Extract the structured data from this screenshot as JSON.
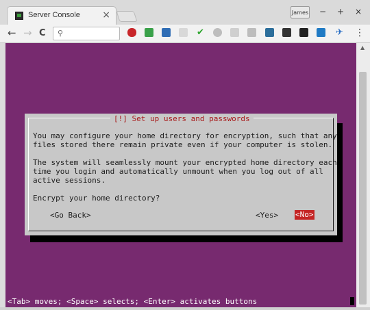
{
  "tab": {
    "title": "Server Console",
    "close": "×",
    "favicon": "terminal-favicon"
  },
  "profile": {
    "name": "James"
  },
  "window": {
    "minimize": "−",
    "maximize": "+",
    "close": "×"
  },
  "nav": {
    "back": "←",
    "forward": "→",
    "reload": "C",
    "search_icon": "🔍"
  },
  "extensions": [
    "ublock-icon",
    "dropbox-icon",
    "stack-icon",
    "puzzle-icon",
    "check-icon",
    "clock-icon",
    "chart-icon",
    "book-icon",
    "screen-icon",
    "docs-icon",
    "calendar-icon",
    "s-icon",
    "plane-icon"
  ],
  "menu": "⋮",
  "terminal": {
    "background": "#772a6f",
    "dialog": {
      "title": "[!] Set up users and passwords",
      "body": "You may configure your home directory for encryption, such that any\nfiles stored there remain private even if your computer is stolen.\n\nThe system will seamlessly mount your encrypted home directory each\ntime you login and automatically unmount when you log out of all\nactive sessions.\n\nEncrypt your home directory?",
      "go_back": "<Go Back>",
      "yes": "<Yes>",
      "no": "<No>"
    },
    "status": "<Tab> moves; <Space> selects; <Enter> activates buttons"
  },
  "colors": {
    "title_red": "#a81a1a",
    "selected_button": "#c42424",
    "dialog_gray": "#c8c8c8"
  }
}
